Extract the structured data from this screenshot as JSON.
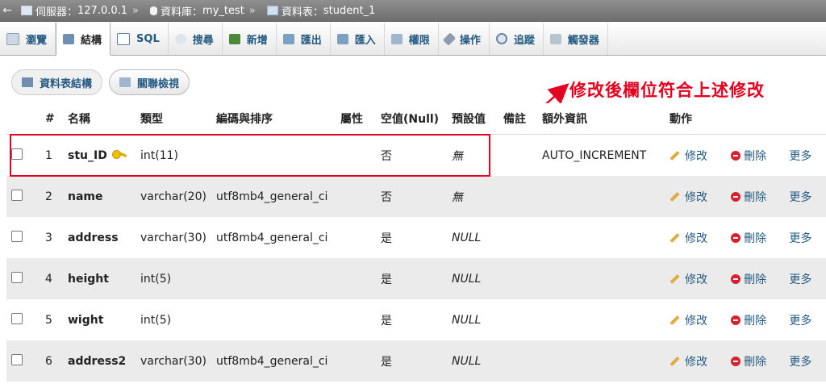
{
  "breadcrumb": {
    "server_label": "伺服器：",
    "server": "127.0.0.1",
    "db_label": "資料庫：",
    "db": "my_test",
    "table_label": "資料表：",
    "table": "student_1",
    "separator": "»"
  },
  "tabs": [
    {
      "label": "瀏覽",
      "icon": "browse-icon"
    },
    {
      "label": "結構",
      "icon": "structure-icon"
    },
    {
      "label": "SQL",
      "icon": "sql-icon"
    },
    {
      "label": "搜尋",
      "icon": "search-icon"
    },
    {
      "label": "新增",
      "icon": "insert-icon"
    },
    {
      "label": "匯出",
      "icon": "export-icon"
    },
    {
      "label": "匯入",
      "icon": "import-icon"
    },
    {
      "label": "權限",
      "icon": "privileges-icon"
    },
    {
      "label": "操作",
      "icon": "operations-icon"
    },
    {
      "label": "追蹤",
      "icon": "tracking-icon"
    },
    {
      "label": "觸發器",
      "icon": "triggers-icon"
    }
  ],
  "subtabs": [
    {
      "label": "資料表結構",
      "icon": "structure-icon"
    },
    {
      "label": "關聯檢視",
      "icon": "relation-icon"
    }
  ],
  "annotation": "修改後欄位符合上述修改",
  "columns": [
    "#",
    "名稱",
    "類型",
    "編碼與排序",
    "屬性",
    "空值(Null)",
    "預設值",
    "備註",
    "額外資訊",
    "動作"
  ],
  "actions": {
    "edit": "修改",
    "drop": "刪除",
    "more": "更多"
  },
  "rows": [
    {
      "num": "1",
      "name": "stu_ID",
      "type": "int(11)",
      "collation": "",
      "attributes": "",
      "null": "否",
      "default": "無",
      "comments": "",
      "extra": "AUTO_INCREMENT",
      "primary": true
    },
    {
      "num": "2",
      "name": "name",
      "type": "varchar(20)",
      "collation": "utf8mb4_general_ci",
      "attributes": "",
      "null": "否",
      "default": "無",
      "comments": "",
      "extra": ""
    },
    {
      "num": "3",
      "name": "address",
      "type": "varchar(30)",
      "collation": "utf8mb4_general_ci",
      "attributes": "",
      "null": "是",
      "default": "NULL",
      "comments": "",
      "extra": ""
    },
    {
      "num": "4",
      "name": "height",
      "type": "int(5)",
      "collation": "",
      "attributes": "",
      "null": "是",
      "default": "NULL",
      "comments": "",
      "extra": ""
    },
    {
      "num": "5",
      "name": "wight",
      "type": "int(5)",
      "collation": "",
      "attributes": "",
      "null": "是",
      "default": "NULL",
      "comments": "",
      "extra": ""
    },
    {
      "num": "6",
      "name": "address2",
      "type": "varchar(30)",
      "collation": "utf8mb4_general_ci",
      "attributes": "",
      "null": "是",
      "default": "NULL",
      "comments": "",
      "extra": ""
    }
  ],
  "colors": {
    "accent": "#235a81",
    "annotation": "#e4001e",
    "row_alt": "#ebebeb"
  }
}
